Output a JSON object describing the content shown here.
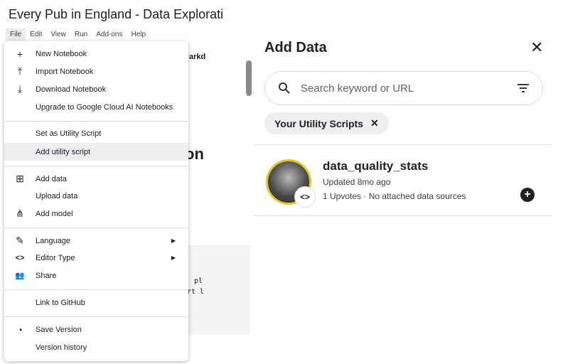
{
  "notebook": {
    "title": "Every Pub in England - Data Explorati",
    "menubar": [
      "File",
      "Edit",
      "View",
      "Run",
      "Add-ons",
      "Help"
    ],
    "bg_markdown": "arkd",
    "bg_heading": "on",
    "bg_code": [
      "pl",
      "rt l"
    ]
  },
  "file_menu": {
    "items": [
      {
        "label": "New Notebook",
        "icon": "+"
      },
      {
        "label": "Import Notebook",
        "icon": "⤒"
      },
      {
        "label": "Download Notebook",
        "icon": "⤓"
      },
      {
        "label": "Upgrade to Google Cloud AI Notebooks",
        "icon": ""
      },
      {
        "label": "Set as Utility Script",
        "icon": ""
      },
      {
        "label": "Add utility script",
        "icon": ""
      },
      {
        "label": "Add data",
        "icon": "⊞"
      },
      {
        "label": "Upload data",
        "icon": ""
      },
      {
        "label": "Add model",
        "icon": "⋔"
      },
      {
        "label": "Language",
        "icon": "✎"
      },
      {
        "label": "Editor Type",
        "icon": "<>"
      },
      {
        "label": "Share",
        "icon": "👥"
      },
      {
        "label": "Link to GitHub",
        "icon": ""
      },
      {
        "label": "Save Version",
        "icon": "◔"
      },
      {
        "label": "Version history",
        "icon": ""
      }
    ],
    "submenu_arrow": "▶"
  },
  "add_data": {
    "title": "Add Data",
    "close": "✕",
    "search_placeholder": "Search keyword or URL",
    "chip": "Your Utility Scripts",
    "chip_close": "✕",
    "result": {
      "title": "data_quality_stats",
      "updated": "Updated 8mo ago",
      "meta": "1 Upvotes · No attached data sources",
      "badge": "<>",
      "add": "+"
    }
  }
}
